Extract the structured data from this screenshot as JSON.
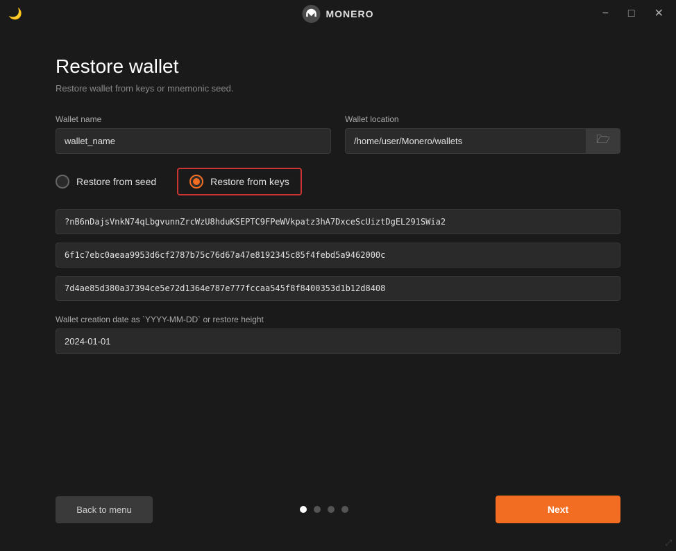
{
  "titlebar": {
    "title": "MONERO",
    "minimize_label": "−",
    "maximize_label": "□",
    "close_label": "✕"
  },
  "page": {
    "title": "Restore wallet",
    "subtitle": "Restore wallet from keys or mnemonic seed."
  },
  "form": {
    "wallet_name_label": "Wallet name",
    "wallet_name_value": "wallet_name",
    "wallet_location_label": "Wallet location",
    "wallet_location_value": "/home/user/Monero/wallets",
    "browse_icon": "📁"
  },
  "restore_options": {
    "seed_label": "Restore from seed",
    "keys_label": "Restore from keys",
    "selected": "keys"
  },
  "key_fields": {
    "field1_value": "?nB6nDajsVnkN74qLbgvunnZrcWzU8hduKSEPTC9FPeWVkpatz3hA7DxceScUiztDgEL291SWia2",
    "field2_value": "6f1c7ebc0aeaa9953d6cf2787b75c76d67a47e8192345c85f4febd5a9462000c",
    "field3_value": "7d4ae85d380a37394ce5e72d1364e787e777fccaa545f8f8400353d1b12d8408"
  },
  "date": {
    "label": "Wallet creation date as `YYYY-MM-DD` or restore height",
    "value": "2024-01-01"
  },
  "buttons": {
    "back_label": "Back to menu",
    "next_label": "Next"
  },
  "pagination": {
    "total": 4,
    "active": 0
  }
}
